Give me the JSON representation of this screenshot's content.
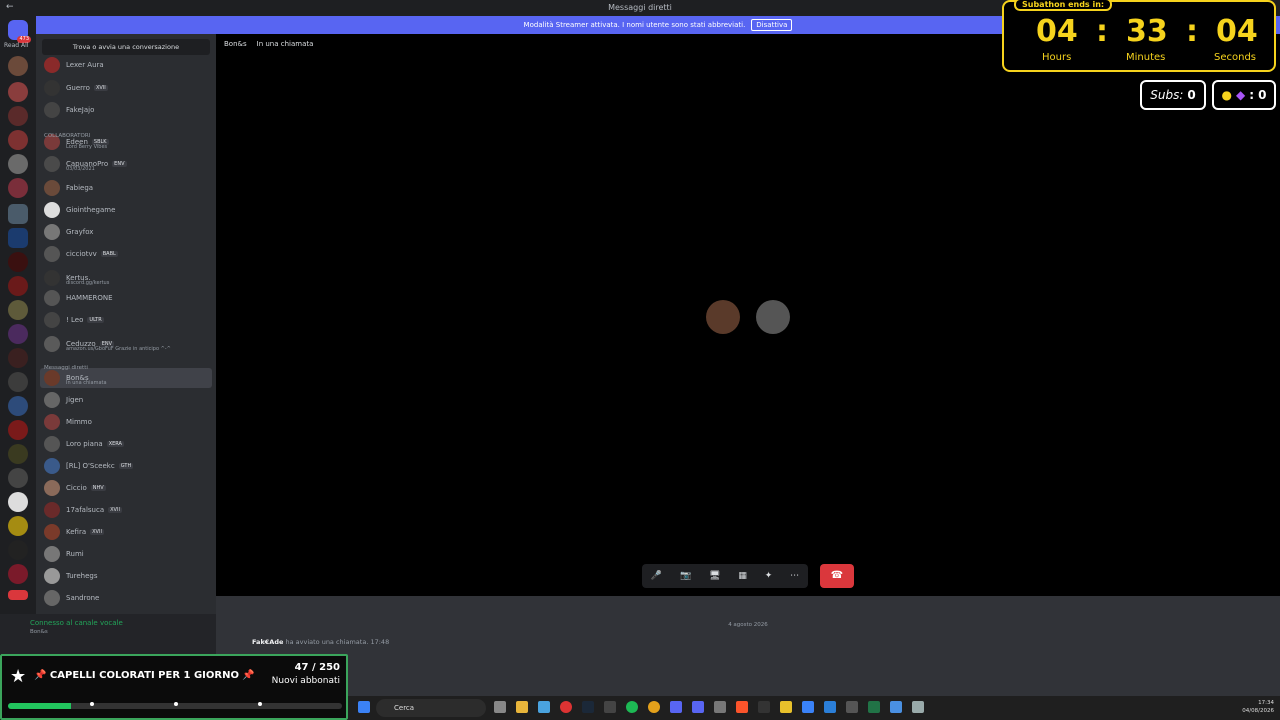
{
  "window": {
    "title": "Messaggi diretti",
    "back_glyph": "←"
  },
  "banner": {
    "text": "Modalità Streamer attivata. I nomi utente sono stati abbreviati.",
    "button": "Disattiva"
  },
  "rail": {
    "read_all": "Read All",
    "home_badge": "473"
  },
  "sidebar": {
    "search_placeholder": "Trova o avvia una conversazione",
    "section_collab": "COLLABORATORI",
    "section_dm": "Messaggi diretti",
    "rows": [
      {
        "name": "Lexer Aura"
      },
      {
        "name": "Guerro",
        "tag": "XVII"
      },
      {
        "name": "FakeJajo"
      },
      {
        "name": "Edeen",
        "tag": "SBLK",
        "sub": "Lord Berry Vibes"
      },
      {
        "name": "CapuanoPro",
        "tag": "ENV",
        "sub": "03/03/2021"
      },
      {
        "name": "Fabiega"
      },
      {
        "name": "Giointhegame"
      },
      {
        "name": "Grayfox"
      },
      {
        "name": "cicciotvv",
        "tag": "BABL"
      },
      {
        "name": "Kertus.",
        "sub": "discord.gg/kertus"
      },
      {
        "name": "HAMMERONE"
      },
      {
        "name": "! Leo",
        "tag": "ULTR"
      },
      {
        "name": "Ceduzzo",
        "tag": "ENV",
        "sub": "amazon.us/GboFuF Grazie in anticipo ^-^"
      },
      {
        "name": "Bon&s",
        "sub": "In una chiamata"
      },
      {
        "name": "Jigen"
      },
      {
        "name": "Mimmo"
      },
      {
        "name": "Loro piana",
        "tag": "XERA"
      },
      {
        "name": "[RL] O'Sceekc",
        "tag": "GTH"
      },
      {
        "name": "Ciccio",
        "tag": "NHV"
      },
      {
        "name": "17afalsuca",
        "tag": "XVII"
      },
      {
        "name": "Kefira",
        "tag": "XVII"
      },
      {
        "name": "Rumi"
      },
      {
        "name": "Turehegs"
      },
      {
        "name": "Sandrone"
      }
    ]
  },
  "voice": {
    "status": "Connesso al canale vocale",
    "user": "Bon&s"
  },
  "call": {
    "header_name": "Bon&s",
    "header_status": "In una chiamata"
  },
  "controls": {
    "mic": "🎤",
    "cam": "📷",
    "screen": "🖥",
    "activity": "▦",
    "sound": "✦",
    "more": "⋯",
    "hangup": "☎"
  },
  "chat": {
    "date": "4 agosto 2026",
    "author": "Fak€Ade",
    "text": "ha avviato una chiamata.",
    "time": "17:48"
  },
  "goal": {
    "title": "📌 CAPELLI COLORATI PER 1 GIORNO 📌",
    "count": "47 / 250",
    "label": "Nuovi abbonati",
    "progress_fraction": 0.188
  },
  "timer": {
    "header": "Subathon ends in:",
    "hours": "04",
    "minutes": "33",
    "seconds": "04",
    "hours_label": "Hours",
    "minutes_label": "Minutes",
    "seconds_label": "Seconds",
    "sep": ":"
  },
  "subs": {
    "label": "Subs:",
    "value": "0"
  },
  "bits": {
    "value": ": 0"
  },
  "taskbar": {
    "search": "Cerca",
    "time": "17:34",
    "date": "04/08/2026"
  }
}
